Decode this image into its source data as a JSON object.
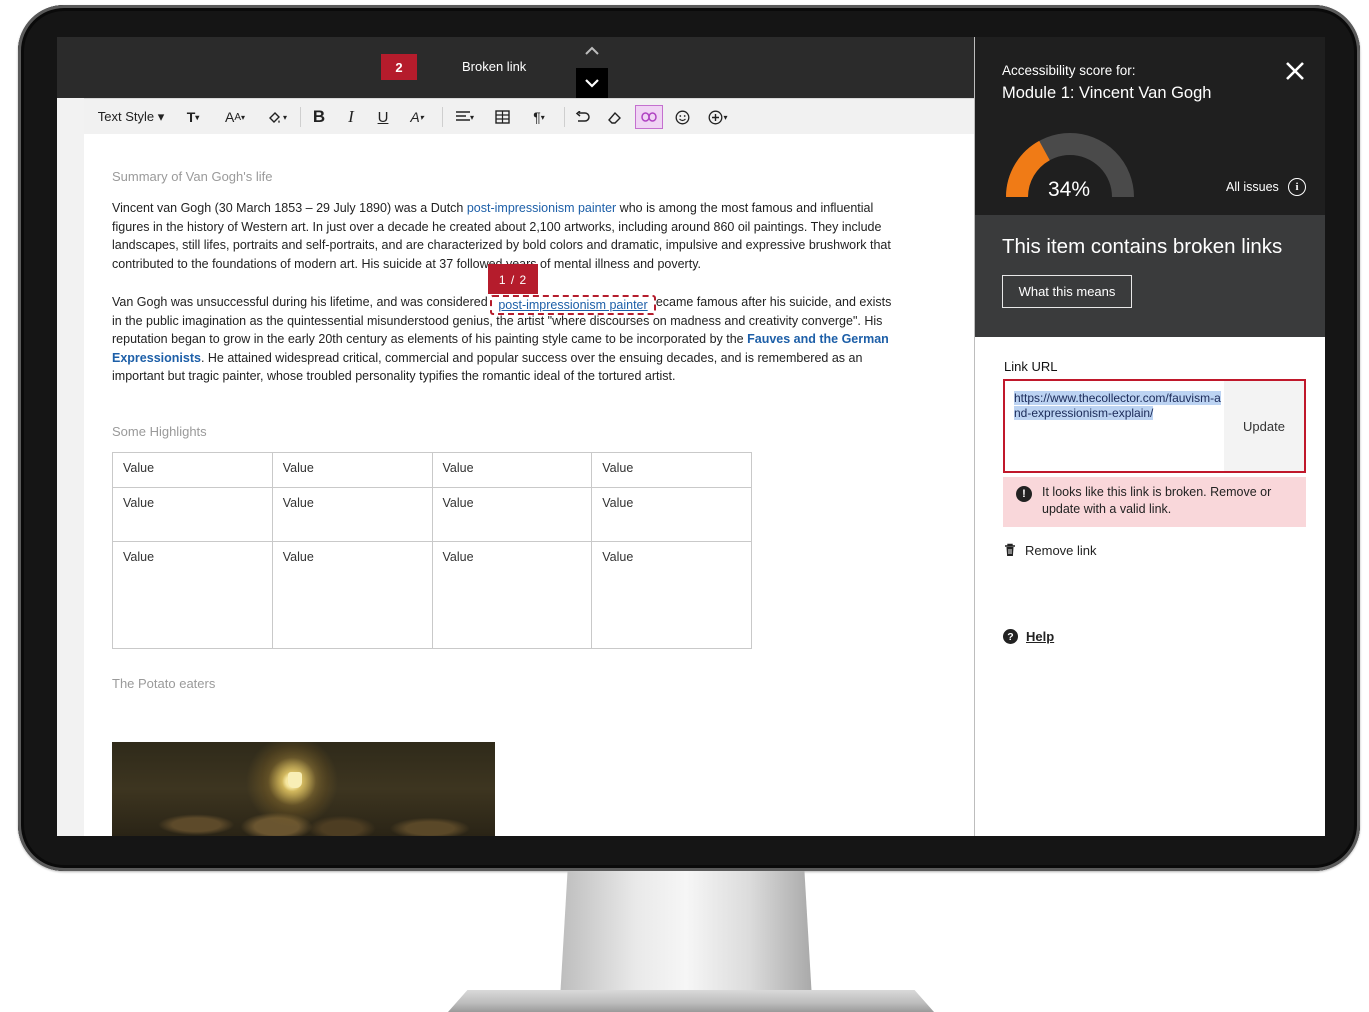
{
  "editor": {
    "topbar": {
      "issue_count": "2",
      "issue_label": "Broken link",
      "nav_up_icon": "chevron-up-icon",
      "nav_down_icon": "chevron-down-icon"
    },
    "toolbar": {
      "text_style_label": "Text Style ▾",
      "icons": [
        "text-format-icon",
        "font-size-icon",
        "highlight-icon",
        "bold-icon",
        "italic-icon",
        "underline-icon",
        "text-color-icon",
        "align-icon",
        "table-icon",
        "paragraph-icon",
        "undo-icon",
        "eraser-icon",
        "link-icon",
        "emoji-icon",
        "insert-icon"
      ],
      "active_color": "#c470cf"
    },
    "document": {
      "heading_summary": "Summary of Van Gogh's life",
      "para1_before": "Vincent van Gogh (30 March 1853 – 29 July 1890) was a Dutch ",
      "para1_link": "post-impressionism painter",
      "para1_after": " who is among the most famous and influential figures in the history of Western art. In just over a decade he created about 2,100 artworks, including around 860 oil paintings. They include landscapes, still lifes, portraits and self-portraits, and are characterized by bold colors and dramatic, impulsive and expressive brushwork that contributed to the foundations of modern art. His suicide at 37 followed years of mental illness and poverty.",
      "para2_before": "Van Gogh was unsuccessful during his lifetime, and was considered a madman and a failure. He became famous after his suicide, and exists in the public imagination as the quintessential misunderstood genius, the artist \"where discourses on madness and creativity converge\".  His reputation began to grow in the early 20th century as elements of his painting style came to be incorporated by the ",
      "para2_link": "Fauves and the German Expressionists",
      "para2_after": ". He attained widespread critical, commercial and popular success over the ensuing decades, and is remembered as an important but tragic painter, whose troubled personality typifies the romantic ideal of the tortured artist.",
      "issue_flag": "1 / 2",
      "heading_highlights": "Some Highlights",
      "table_rows": [
        [
          "Value",
          "Value",
          "Value",
          "Value"
        ],
        [
          "Value",
          "Value",
          "Value",
          "Value"
        ],
        [
          "Value",
          "Value",
          "Value",
          "Value"
        ]
      ],
      "heading_potato": "The Potato eaters"
    },
    "error_color": "#b51c2c",
    "link_color": "#1d5fa8"
  },
  "panel": {
    "caption": "Accessibility score for:",
    "title": "Module 1: Vincent Van Gogh",
    "close_icon": "close-icon",
    "score": 34,
    "score_label": "34%",
    "gauge_color": "#f07b16",
    "all_issues_label": "All issues",
    "band_message": "This item contains broken links",
    "what_means_label": "What this means",
    "link_url_label": "Link URL",
    "link_url_value": "https://www.thecollector.com/fauvism-and-expressionism-explain/",
    "update_label": "Update",
    "error_message": "It looks like this link is broken. Remove or update with a valid link.",
    "remove_link_label": "Remove link",
    "help_label": "Help"
  }
}
